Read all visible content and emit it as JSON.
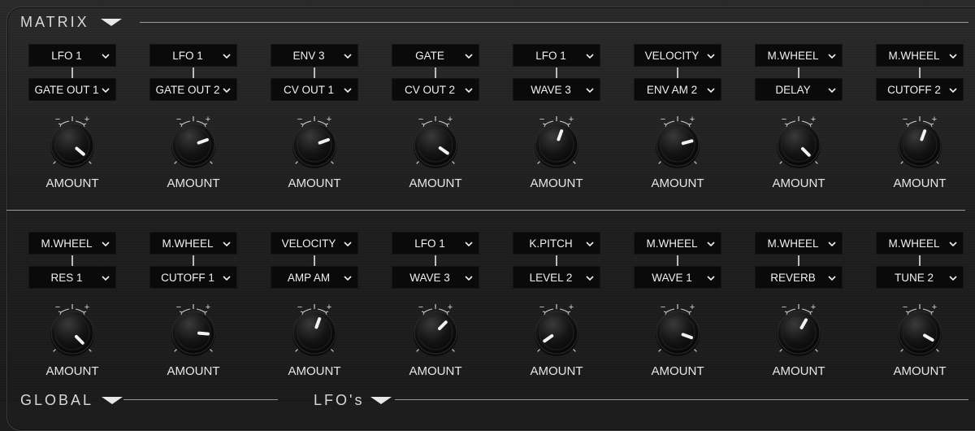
{
  "header": {
    "title": "MATRIX"
  },
  "rows": [
    {
      "slots": [
        {
          "source": "LFO 1",
          "dest": "GATE OUT 1",
          "amount_label": "AMOUNT",
          "angle": 130
        },
        {
          "source": "LFO 1",
          "dest": "GATE OUT 2",
          "amount_label": "AMOUNT",
          "angle": 70
        },
        {
          "source": "ENV 3",
          "dest": "CV OUT 1",
          "amount_label": "AMOUNT",
          "angle": 70
        },
        {
          "source": "GATE",
          "dest": "CV OUT 2",
          "amount_label": "AMOUNT",
          "angle": 125
        },
        {
          "source": "LFO 1",
          "dest": "WAVE 3",
          "amount_label": "AMOUNT",
          "angle": 20
        },
        {
          "source": "VELOCITY",
          "dest": "ENV AM 2",
          "amount_label": "AMOUNT",
          "angle": 75
        },
        {
          "source": "M.WHEEL",
          "dest": "DELAY",
          "amount_label": "AMOUNT",
          "angle": 135
        },
        {
          "source": "M.WHEEL",
          "dest": "CUTOFF 2",
          "amount_label": "AMOUNT",
          "angle": 20
        }
      ]
    },
    {
      "slots": [
        {
          "source": "M.WHEEL",
          "dest": "RES 1",
          "amount_label": "AMOUNT",
          "angle": 135
        },
        {
          "source": "M.WHEEL",
          "dest": "CUTOFF 1",
          "amount_label": "AMOUNT",
          "angle": 95
        },
        {
          "source": "VELOCITY",
          "dest": "AMP AM",
          "amount_label": "AMOUNT",
          "angle": 20
        },
        {
          "source": "LFO 1",
          "dest": "WAVE 3",
          "amount_label": "AMOUNT",
          "angle": 45
        },
        {
          "source": "K.PITCH",
          "dest": "LEVEL 2",
          "amount_label": "AMOUNT",
          "angle": 235
        },
        {
          "source": "M.WHEEL",
          "dest": "WAVE 1",
          "amount_label": "AMOUNT",
          "angle": 110
        },
        {
          "source": "M.WHEEL",
          "dest": "REVERB",
          "amount_label": "AMOUNT",
          "angle": 30
        },
        {
          "source": "M.WHEEL",
          "dest": "TUNE 2",
          "amount_label": "AMOUNT",
          "angle": 120
        }
      ]
    }
  ],
  "footer": {
    "global_title": "GLOBAL",
    "lfos_title": "LFO's"
  },
  "knob_marks": {
    "minus": "−",
    "plus": "+"
  }
}
